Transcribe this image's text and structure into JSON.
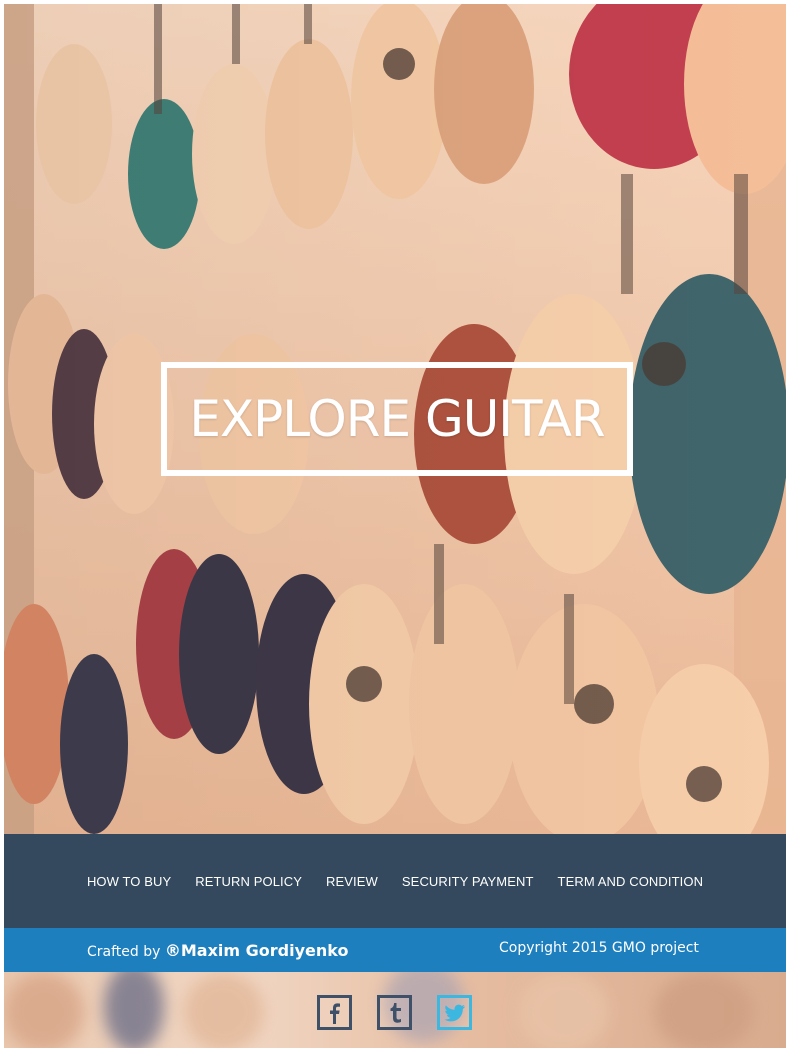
{
  "hero": {
    "title": "EXPLORE GUITAR"
  },
  "footer_nav": {
    "items": [
      {
        "label": "HOW TO BUY"
      },
      {
        "label": "RETURN POLICY"
      },
      {
        "label": "REVIEW"
      },
      {
        "label": "SECURITY PAYMENT"
      },
      {
        "label": "TERM AND CONDITION"
      }
    ]
  },
  "credits": {
    "crafted_prefix": "Crafted by ",
    "author": "®Maxim Gordiyenko",
    "copyright": "Copyright 2015 GMO project"
  },
  "social": {
    "icons": [
      {
        "name": "facebook-icon",
        "glyph": "f"
      },
      {
        "name": "tumblr-icon",
        "glyph": "t"
      },
      {
        "name": "twitter-icon",
        "glyph": "bird"
      }
    ]
  },
  "colors": {
    "nav_bg": "#34495e",
    "credits_bg": "#1e7fbf",
    "icon_border": "#3f5169",
    "twitter_accent": "#3bb7e0"
  }
}
